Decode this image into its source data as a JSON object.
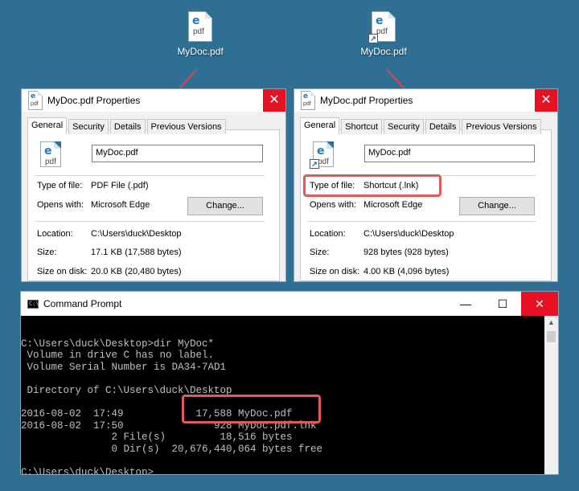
{
  "desktop": {
    "icon_pdf": {
      "label": "MyDoc.pdf",
      "glyph": "e",
      "ext": "pdf"
    },
    "icon_shortcut": {
      "label": "MyDoc.pdf",
      "glyph": "e",
      "ext": "pdf",
      "overlay": "↗"
    }
  },
  "dialog_left": {
    "title": "MyDoc.pdf Properties",
    "close": "✕",
    "tabs": [
      "General",
      "Security",
      "Details",
      "Previous Versions"
    ],
    "name_value": "MyDoc.pdf",
    "type_label": "Type of file:",
    "type_value": "PDF File (.pdf)",
    "opens_label": "Opens with:",
    "opens_value": "Microsoft Edge",
    "change_button": "Change...",
    "location_label": "Location:",
    "location_value": "C:\\Users\\duck\\Desktop",
    "size_label": "Size:",
    "size_value": "17.1 KB (17,588 bytes)",
    "disk_label": "Size on disk:",
    "disk_value": "20.0 KB (20,480 bytes)"
  },
  "dialog_right": {
    "title": "MyDoc.pdf Properties",
    "close": "✕",
    "tabs": [
      "General",
      "Shortcut",
      "Security",
      "Details",
      "Previous Versions"
    ],
    "name_value": "MyDoc.pdf",
    "type_label": "Type of file:",
    "type_value": "Shortcut (.lnk)",
    "opens_label": "Opens with:",
    "opens_value": "Microsoft Edge",
    "change_button": "Change...",
    "location_label": "Location:",
    "location_value": "C:\\Users\\duck\\Desktop",
    "size_label": "Size:",
    "size_value": "928 bytes (928 bytes)",
    "disk_label": "Size on disk:",
    "disk_value": "4.00 KB (4,096 bytes)"
  },
  "cmd": {
    "title": "Command Prompt",
    "icon_text": "C:\\",
    "minimize": "—",
    "maximize": "☐",
    "close": "✕",
    "lines": [
      "C:\\Users\\duck\\Desktop>dir MyDoc*",
      " Volume in drive C has no label.",
      " Volume Serial Number is DA34-7AD1",
      "",
      " Directory of C:\\Users\\duck\\Desktop",
      "",
      "2016-08-02  17:49            17,588 MyDoc.pdf",
      "2016-08-02  17:50               928 MyDoc.pdf.lnk",
      "               2 File(s)         18,516 bytes",
      "               0 Dir(s)  20,676,440,064 bytes free",
      "",
      "C:\\Users\\duck\\Desktop>"
    ],
    "scroll_up": "▲"
  },
  "colors": {
    "desktop": "#2e6f93",
    "highlight": "#e05a5a",
    "close": "#e81123"
  }
}
